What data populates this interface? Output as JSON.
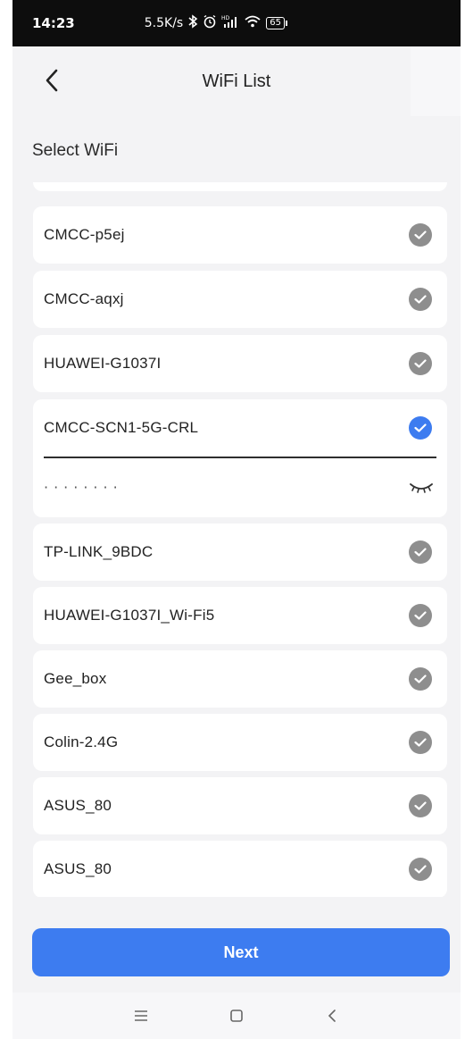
{
  "status_bar": {
    "time": "14:23",
    "speed": "5.5K/s",
    "battery": "65",
    "icons": [
      "bluetooth-icon",
      "alarm-icon",
      "signal-icon",
      "wifi-icon",
      "battery-icon"
    ]
  },
  "header": {
    "title": "WiFi List",
    "back_icon": "chevron-left-icon"
  },
  "section": {
    "label": "Select WiFi"
  },
  "networks": [
    {
      "name": "CMCC-p5ej",
      "selected": false
    },
    {
      "name": "CMCC-aqxj",
      "selected": false
    },
    {
      "name": "HUAWEI-G1037I",
      "selected": false
    },
    {
      "name": "CMCC-SCN1-5G-CRL",
      "selected": true
    },
    {
      "name": "TP-LINK_9BDC",
      "selected": false
    },
    {
      "name": "HUAWEI-G1037I_Wi-Fi5",
      "selected": false
    },
    {
      "name": "Gee_box",
      "selected": false
    },
    {
      "name": "Colin-2.4G",
      "selected": false
    },
    {
      "name": "ASUS_80",
      "selected": false
    },
    {
      "name": "ASUS_80",
      "selected": false
    }
  ],
  "password": {
    "value": "········",
    "visibility_icon": "eye-closed-icon"
  },
  "next_button": {
    "label": "Next"
  },
  "nav_bar": {
    "icons": [
      "menu-icon",
      "home-icon",
      "back-icon"
    ]
  },
  "colors": {
    "accent": "#3d7cf0",
    "check_unselected": "#8e8e8e",
    "background": "#f3f3f5",
    "card": "#ffffff"
  }
}
